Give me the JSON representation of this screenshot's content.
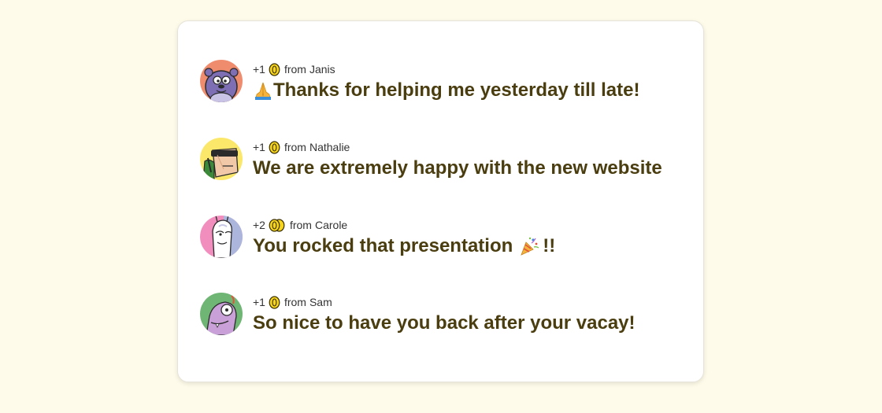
{
  "colors": {
    "page_bg": "#fffbea",
    "card_bg": "#ffffff",
    "message_text": "#4a3d0f",
    "coin": "#f7d51d"
  },
  "kudos": [
    {
      "points": "+1",
      "coin_count": 1,
      "from_word": "from",
      "sender": "Janis",
      "message_emoji": "folded-hands-icon",
      "message": "Thanks for helping me yesterday till late!",
      "message_suffix": "",
      "avatar": {
        "icon": "purple-creature-avatar",
        "bg": "#f08c6e"
      }
    },
    {
      "points": "+1",
      "coin_count": 1,
      "from_word": "from",
      "sender": "Nathalie",
      "message_emoji": "",
      "message": "We are extremely happy with the new website",
      "message_suffix": "",
      "avatar": {
        "icon": "sunglasses-character-avatar",
        "bg": "#fbe86a"
      }
    },
    {
      "points": "+2",
      "coin_count": 2,
      "from_word": "from",
      "sender": "Carole",
      "message_emoji": "",
      "message": "You rocked that presentation",
      "message_suffix": "!!",
      "suffix_emoji": "party-popper-icon",
      "avatar": {
        "icon": "llama-character-avatar",
        "bg": "#f28ebe"
      }
    },
    {
      "points": "+1",
      "coin_count": 1,
      "from_word": "from",
      "sender": "Sam",
      "message_emoji": "",
      "message": "So nice to have you back after your vacay!",
      "message_suffix": "",
      "avatar": {
        "icon": "lizard-character-avatar",
        "bg": "#6fb574"
      }
    }
  ]
}
